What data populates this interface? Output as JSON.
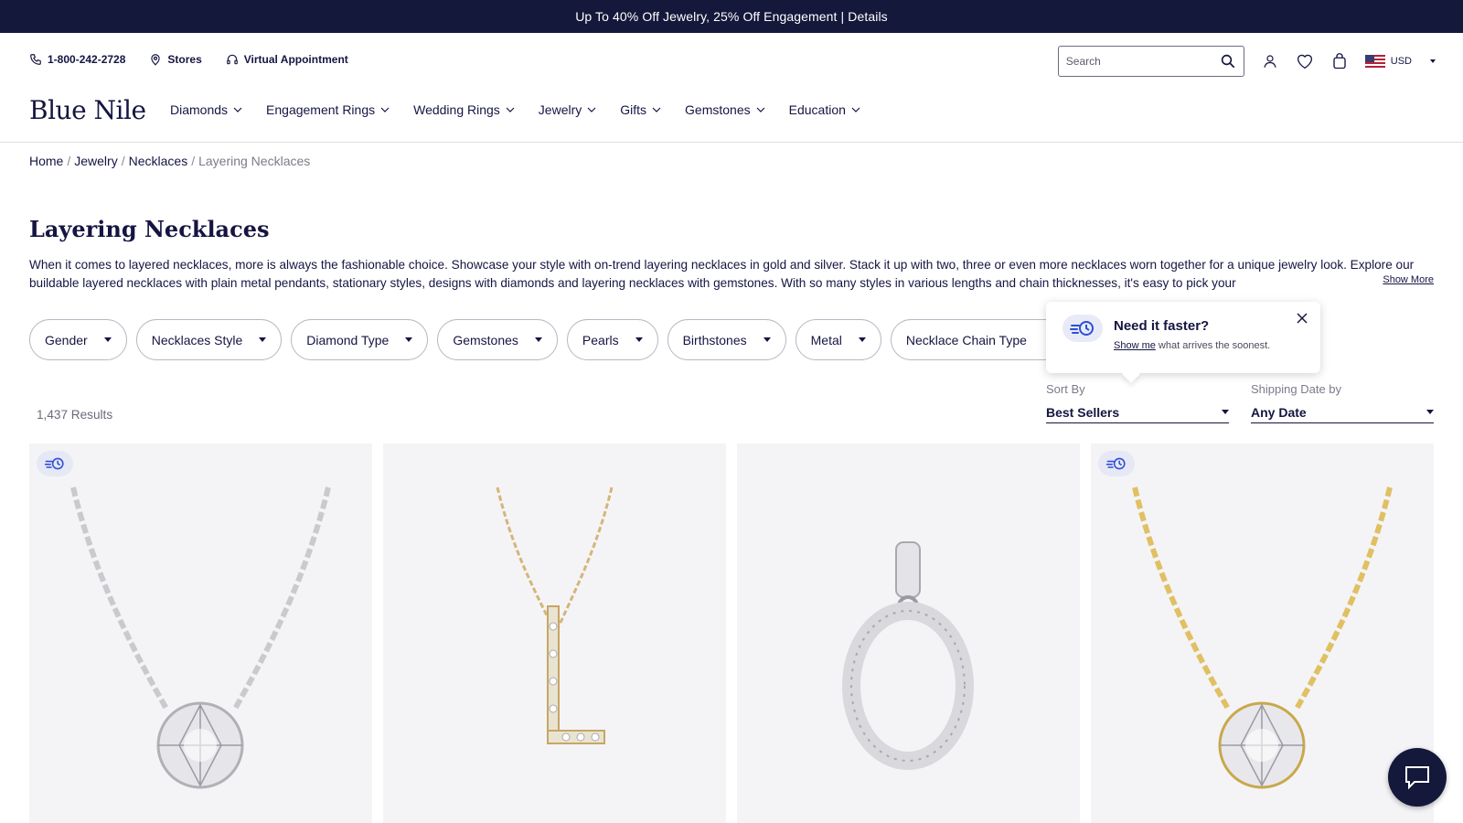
{
  "promo": {
    "text": "Up To 40% Off Jewelry, 25% Off Engagement | Details"
  },
  "utility": {
    "phone": "1-800-242-2728",
    "stores": "Stores",
    "virtual": "Virtual Appointment",
    "search_placeholder": "Search",
    "currency": "USD"
  },
  "brand": {
    "logo": "Blue Nile"
  },
  "nav": {
    "items": [
      {
        "label": "Diamonds"
      },
      {
        "label": "Engagement Rings"
      },
      {
        "label": "Wedding Rings"
      },
      {
        "label": "Jewelry"
      },
      {
        "label": "Gifts"
      },
      {
        "label": "Gemstones"
      },
      {
        "label": "Education"
      }
    ]
  },
  "breadcrumb": {
    "items": [
      "Home",
      "Jewelry",
      "Necklaces"
    ],
    "current": "Layering Necklaces"
  },
  "page": {
    "title": "Layering Necklaces",
    "description": "When it comes to layered necklaces, more is always the fashionable choice. Showcase your style with on-trend layering necklaces in gold and silver. Stack it up with two, three or even more necklaces worn together for a unique jewelry look. Explore our buildable layered necklaces with plain metal pendants, stationary styles, designs with diamonds and layering necklaces with gemstones. With so many styles in various lengths and chain thicknesses, it's easy to pick your",
    "show_more": "Show More"
  },
  "filters": {
    "items": [
      {
        "label": "Gender"
      },
      {
        "label": "Necklaces Style"
      },
      {
        "label": "Diamond Type"
      },
      {
        "label": "Gemstones"
      },
      {
        "label": "Pearls"
      },
      {
        "label": "Birthstones"
      },
      {
        "label": "Metal"
      },
      {
        "label": "Necklace Chain Type"
      }
    ]
  },
  "tooltip": {
    "title": "Need it faster?",
    "link": "Show me",
    "body": " what arrives the soonest."
  },
  "sort": {
    "sort_label": "Sort By",
    "sort_value": "Best Sellers",
    "ship_label": "Shipping Date by",
    "ship_value": "Any Date"
  },
  "results": {
    "count": "1,437 Results"
  },
  "colors": {
    "navy": "#14183b",
    "text": "#151542",
    "card_bg": "#f4f4f6",
    "gold": "#d9b96a",
    "silver": "#c8c8cc"
  }
}
